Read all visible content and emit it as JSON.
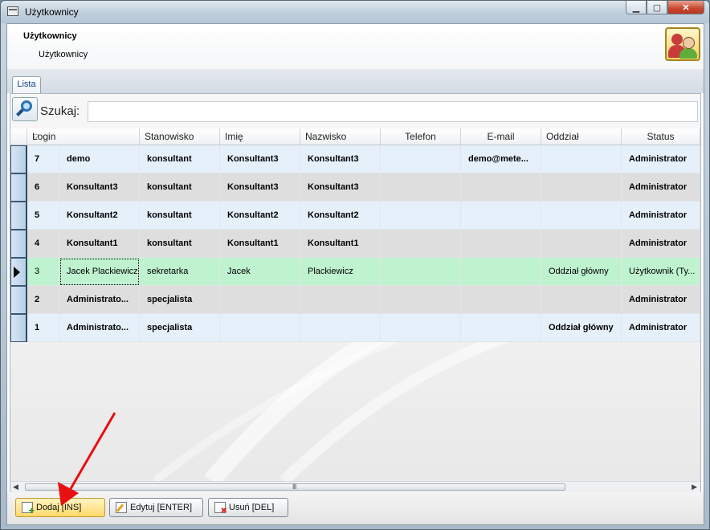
{
  "window": {
    "title": "Użytkownicy"
  },
  "header": {
    "title": "Użytkownicy",
    "subtitle": "Użytkownicy",
    "icon": "users-icon"
  },
  "tabs": [
    {
      "label": "Lista"
    }
  ],
  "search": {
    "label": "Szukaj:",
    "value": ""
  },
  "grid": {
    "columns": [
      "",
      "Login",
      "Stanowisko",
      "Imię",
      "Nazwisko",
      "Telefon",
      "E-mail",
      "Oddział",
      "Status"
    ],
    "rows": [
      {
        "id": "7",
        "login": "demo",
        "stanowisko": "konsultant",
        "imie": "Konsultant3",
        "nazwisko": "Konsultant3",
        "telefon": "",
        "email": "demo@mete...",
        "oddzial": "",
        "status": "Administrator",
        "bold": true
      },
      {
        "id": "6",
        "login": "Konsultant3",
        "stanowisko": "konsultant",
        "imie": "Konsultant3",
        "nazwisko": "Konsultant3",
        "telefon": "",
        "email": "",
        "oddzial": "",
        "status": "Administrator",
        "bold": true
      },
      {
        "id": "5",
        "login": "Konsultant2",
        "stanowisko": "konsultant",
        "imie": "Konsultant2",
        "nazwisko": "Konsultant2",
        "telefon": "",
        "email": "",
        "oddzial": "",
        "status": "Administrator",
        "bold": true
      },
      {
        "id": "4",
        "login": "Konsultant1",
        "stanowisko": "konsultant",
        "imie": "Konsultant1",
        "nazwisko": "Konsultant1",
        "telefon": "",
        "email": "",
        "oddzial": "",
        "status": "Administrator",
        "bold": true
      },
      {
        "id": "3",
        "login": "Jacek Plackiewicz",
        "stanowisko": "sekretarka",
        "imie": "Jacek",
        "nazwisko": "Plackiewicz",
        "telefon": "",
        "email": "",
        "oddzial": "Oddział główny",
        "status": "Użytkownik (Ty...",
        "bold": false,
        "selected": true
      },
      {
        "id": "2",
        "login": "Administrato...",
        "stanowisko": "specjalista",
        "imie": "",
        "nazwisko": "",
        "telefon": "",
        "email": "",
        "oddzial": "",
        "status": "Administrator",
        "bold": true
      },
      {
        "id": "1",
        "login": "Administrato...",
        "stanowisko": "specjalista",
        "imie": "",
        "nazwisko": "",
        "telefon": "",
        "email": "",
        "oddzial": "Oddział główny",
        "status": "Administrator",
        "bold": true
      }
    ]
  },
  "buttons": {
    "add": "Dodaj [INS]",
    "edit": "Edytuj [ENTER]",
    "delete": "Usuń [DEL]"
  },
  "scrollbar": {
    "grip": "III"
  },
  "colors": {
    "row_even": "#e6f0fb",
    "row_odd": "#dedede",
    "row_selected": "#bff2cf",
    "annotation_arrow": "#e81010"
  }
}
